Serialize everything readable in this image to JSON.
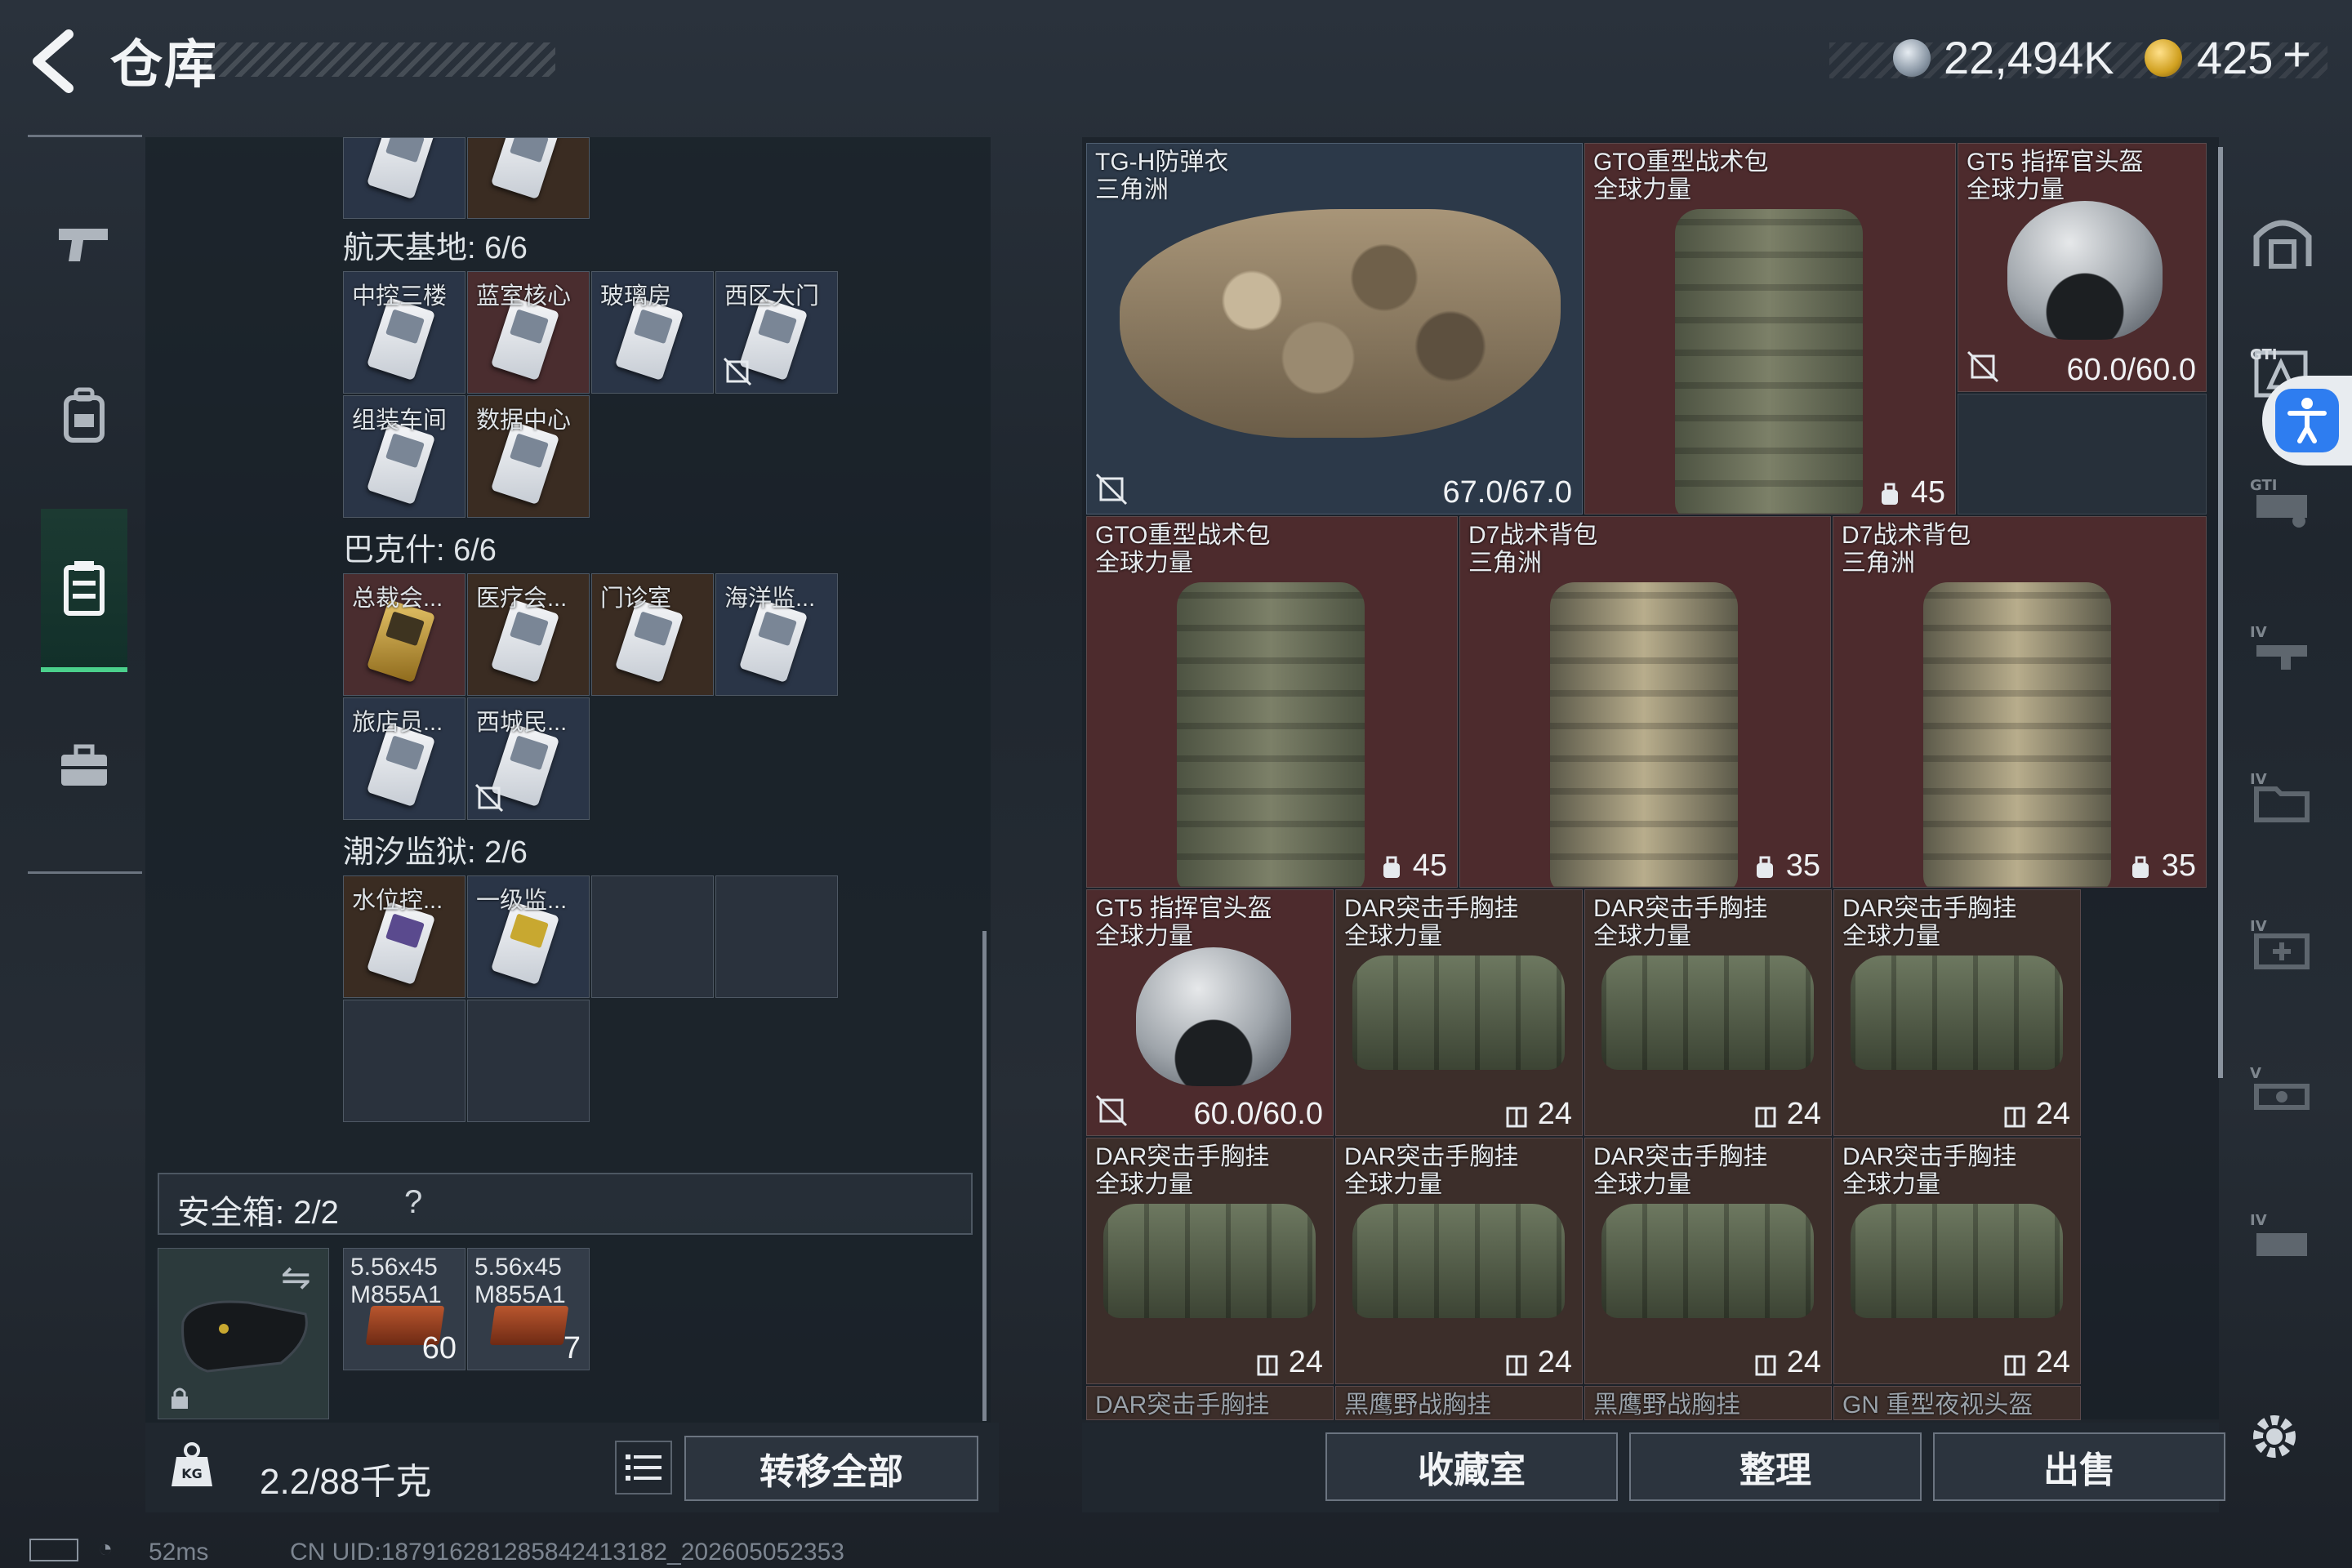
{
  "header": {
    "back_icon": "back-arrow-icon",
    "title": "仓库"
  },
  "currency": {
    "silver": "22,494K",
    "gold": "425",
    "add_label": "+"
  },
  "left_nav": [
    {
      "icon": "pistol-icon"
    },
    {
      "icon": "backpack-icon"
    },
    {
      "icon": "storage-locker-icon",
      "active": true
    },
    {
      "icon": "toolbox-icon"
    }
  ],
  "keys": {
    "section1": {
      "title": "航天基地: 6/6",
      "items": [
        "中控三楼",
        "蓝室核心",
        "玻璃房",
        "西区大门",
        "组装车间",
        "数据中心"
      ]
    },
    "section2": {
      "title": "巴克什: 6/6",
      "items": [
        "总裁会...",
        "医疗会...",
        "门诊室",
        "海洋监...",
        "旅店员...",
        "西城民..."
      ]
    },
    "section3": {
      "title": "潮汐监狱: 2/6",
      "items": [
        "水位控...",
        "一级监..."
      ]
    }
  },
  "safe_box": {
    "label": "安全箱: 2/2",
    "help": "?",
    "ammo": [
      {
        "name_line1": "5.56x45",
        "name_line2": "M855A1",
        "count": "60"
      },
      {
        "name_line1": "5.56x45",
        "name_line2": "M855A1",
        "count": "7"
      }
    ]
  },
  "capacity": {
    "weight": "2.2/88千克",
    "transfer_label": "转移全部"
  },
  "items": [
    {
      "name": "TG-H防弹衣",
      "tag": "三角洲",
      "value": "67.0/67.0",
      "rarity": "blue"
    },
    {
      "name": "GTO重型战术包",
      "tag": "全球力量",
      "value": "45",
      "rarity": "red"
    },
    {
      "name": "GT5 指挥官头盔",
      "tag": "全球力量",
      "value": "60.0/60.0",
      "rarity": "red"
    },
    {
      "name": "GTO重型战术包",
      "tag": "全球力量",
      "value": "45",
      "rarity": "red"
    },
    {
      "name": "D7战术背包",
      "tag": "三角洲",
      "value": "35",
      "rarity": "red"
    },
    {
      "name": "D7战术背包",
      "tag": "三角洲",
      "value": "35",
      "rarity": "red"
    },
    {
      "name": "GT5 指挥官头盔",
      "tag": "全球力量",
      "value": "60.0/60.0",
      "rarity": "red"
    },
    {
      "name": "DAR突击手胸挂",
      "tag": "全球力量",
      "value": "24",
      "rarity": "brown"
    },
    {
      "name": "DAR突击手胸挂",
      "tag": "全球力量",
      "value": "24",
      "rarity": "brown"
    },
    {
      "name": "DAR突击手胸挂",
      "tag": "全球力量",
      "value": "24",
      "rarity": "brown"
    },
    {
      "name": "DAR突击手胸挂",
      "tag": "全球力量",
      "value": "24",
      "rarity": "brown"
    },
    {
      "name": "DAR突击手胸挂",
      "tag": "全球力量",
      "value": "24",
      "rarity": "brown"
    },
    {
      "name": "DAR突击手胸挂",
      "tag": "全球力量",
      "value": "24",
      "rarity": "brown"
    },
    {
      "name": "DAR突击手胸挂",
      "tag": "全球力量",
      "value": "24",
      "rarity": "brown"
    }
  ],
  "next_row_labels": [
    "DAR突击手胸挂",
    "黑鹰野战胸挂",
    "黑鹰野战胸挂",
    "GN 重型夜视头盔"
  ],
  "bottom_tabs": {
    "favorites": "收藏室",
    "organize": "整理",
    "sell": "出售"
  },
  "right_bar_tags": [
    "GTI",
    "GTI",
    "IV",
    "IV",
    "IV",
    "V",
    "IV"
  ],
  "status": {
    "ping": "52ms",
    "uid": "CN UID:18791628128584241318​2_202605052353"
  }
}
